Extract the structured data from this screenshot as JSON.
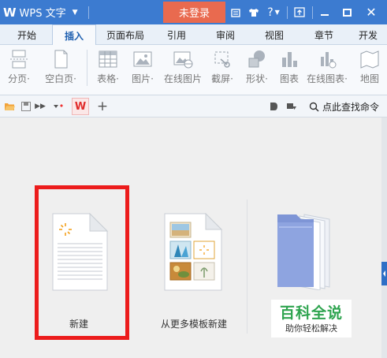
{
  "titlebar": {
    "app_name": "WPS 文字",
    "login_label": "未登录",
    "help_label": "?",
    "bg_color": "#3c7bd0",
    "login_color": "#e96a4f"
  },
  "tabs": [
    {
      "label": "开始"
    },
    {
      "label": "插入",
      "active": true
    },
    {
      "label": "页面布局"
    },
    {
      "label": "引用"
    },
    {
      "label": "审阅"
    },
    {
      "label": "视图"
    },
    {
      "label": "章节"
    },
    {
      "label": "开发"
    }
  ],
  "ribbon": {
    "items": [
      {
        "label": "分页·",
        "icon": "page-break-icon"
      },
      {
        "label": "空白页·",
        "icon": "blank-page-icon"
      },
      {
        "label": "表格·",
        "icon": "table-icon"
      },
      {
        "label": "图片·",
        "icon": "picture-icon"
      },
      {
        "label": "在线图片",
        "icon": "online-picture-icon"
      },
      {
        "label": "截屏·",
        "icon": "screenshot-icon"
      },
      {
        "label": "形状·",
        "icon": "shape-icon"
      },
      {
        "label": "图表",
        "icon": "chart-icon"
      },
      {
        "label": "在线图表·",
        "icon": "online-chart-icon"
      },
      {
        "label": "地图",
        "icon": "map-icon"
      }
    ]
  },
  "quickbar": {
    "search_label": "点此查找命令"
  },
  "content": {
    "new_label": "新建",
    "template_label": "从更多模板新建"
  },
  "watermark": {
    "title": "百科全说",
    "subtitle": "助你轻松解决"
  }
}
